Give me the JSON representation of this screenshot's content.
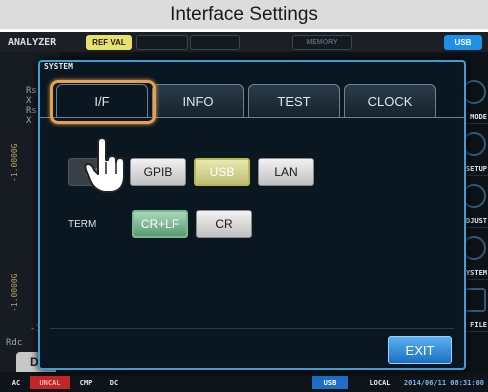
{
  "caption": "Interface Settings",
  "topbar": {
    "analyzer": "ANALYZER",
    "ref_val": "REF VAL",
    "memory": "MEMORY",
    "usb": "USB"
  },
  "background": {
    "left_labels": [
      "Rs",
      "X",
      "Rs",
      "X"
    ],
    "axis_top": "-1.0000G",
    "axis_bottom": "-1.0000G",
    "rdc_label": "Rdc",
    "minus_one": "-1.",
    "dl_button": "DI"
  },
  "right_menu": [
    {
      "label": "MODE",
      "icon": "mode-icon"
    },
    {
      "label": "SETUP",
      "icon": "setup-icon"
    },
    {
      "label": "DJUST",
      "icon": "adjust-icon"
    },
    {
      "label": "YSTEM",
      "icon": "system-icon"
    },
    {
      "label": "FILE",
      "icon": "file-icon"
    }
  ],
  "dialog": {
    "title": "SYSTEM",
    "tabs": [
      {
        "label": "I/F",
        "active": true
      },
      {
        "label": "INFO",
        "active": false
      },
      {
        "label": "TEST",
        "active": false
      },
      {
        "label": "CLOCK",
        "active": false
      }
    ],
    "interface_buttons": {
      "rs": "RS",
      "gpib": "GPIB",
      "usb": "USB",
      "lan": "LAN",
      "selected": "USB"
    },
    "term": {
      "label": "TERM",
      "crlf": "CR+LF",
      "cr": "CR",
      "selected": "CR+LF"
    },
    "exit": "EXIT"
  },
  "bottombar": {
    "ac": "AC",
    "lineavg": "UNCAL",
    "cmp": "CMP",
    "dc": "DC",
    "usb": "USB",
    "local": "LOCAL",
    "datetime": "2014/06/11 08:31:00"
  },
  "colors": {
    "accent": "#3aa0d8",
    "highlight": "#e8a050",
    "selected_usb": "#c0c078",
    "selected_term": "#5a9a70",
    "exit": "#1a70c0"
  }
}
